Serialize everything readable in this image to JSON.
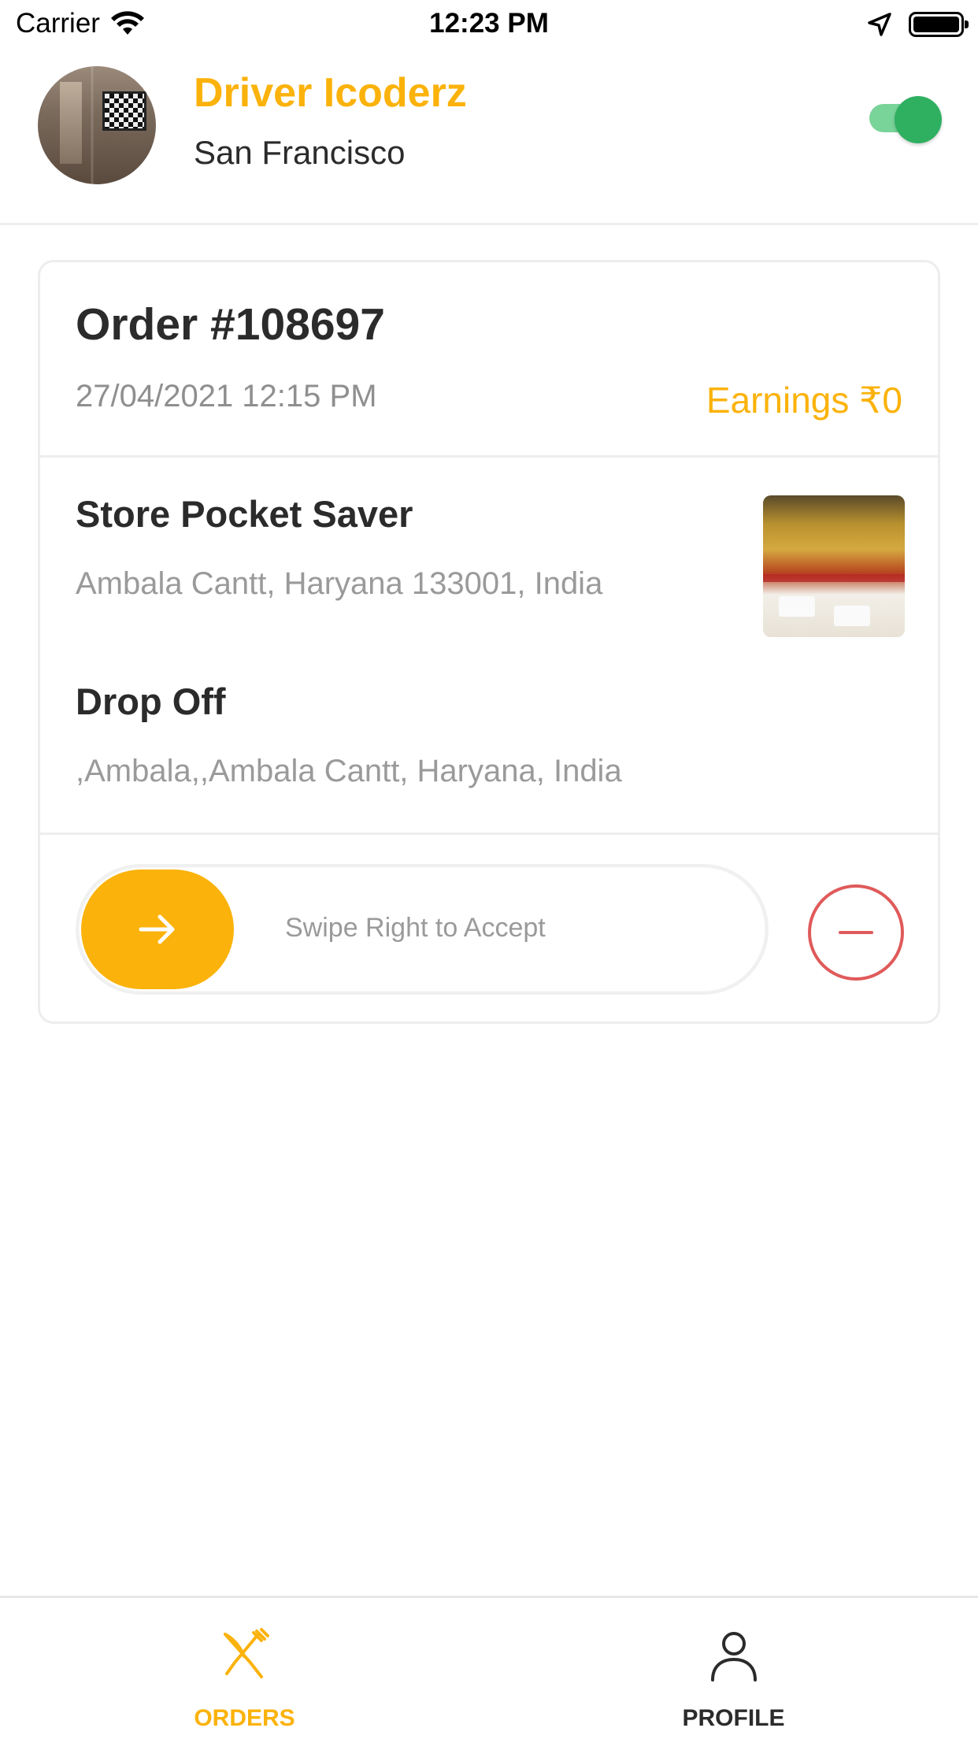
{
  "status_bar": {
    "carrier": "Carrier",
    "time": "12:23 PM"
  },
  "header": {
    "driver_name": "Driver Icoderz",
    "city": "San Francisco",
    "online_toggle": true
  },
  "order": {
    "title": "Order #108697",
    "datetime": "27/04/2021 12:15 PM",
    "earnings": "Earnings ₹0",
    "store_name": "Store Pocket Saver",
    "store_address": "Ambala Cantt, Haryana 133001, India",
    "dropoff_title": "Drop Off",
    "dropoff_address": ",Ambala,,Ambala Cantt, Haryana, India",
    "swipe_label": "Swipe Right to Accept"
  },
  "tab_bar": {
    "tabs": [
      {
        "label": "ORDERS",
        "icon": "fork-knife-icon",
        "active": true
      },
      {
        "label": "PROFILE",
        "icon": "user-icon",
        "active": false
      }
    ]
  },
  "colors": {
    "accent": "#fbb20a",
    "toggle_on": "#2fb061",
    "decline": "#e05a5a",
    "muted_text": "#9a9a9a"
  }
}
